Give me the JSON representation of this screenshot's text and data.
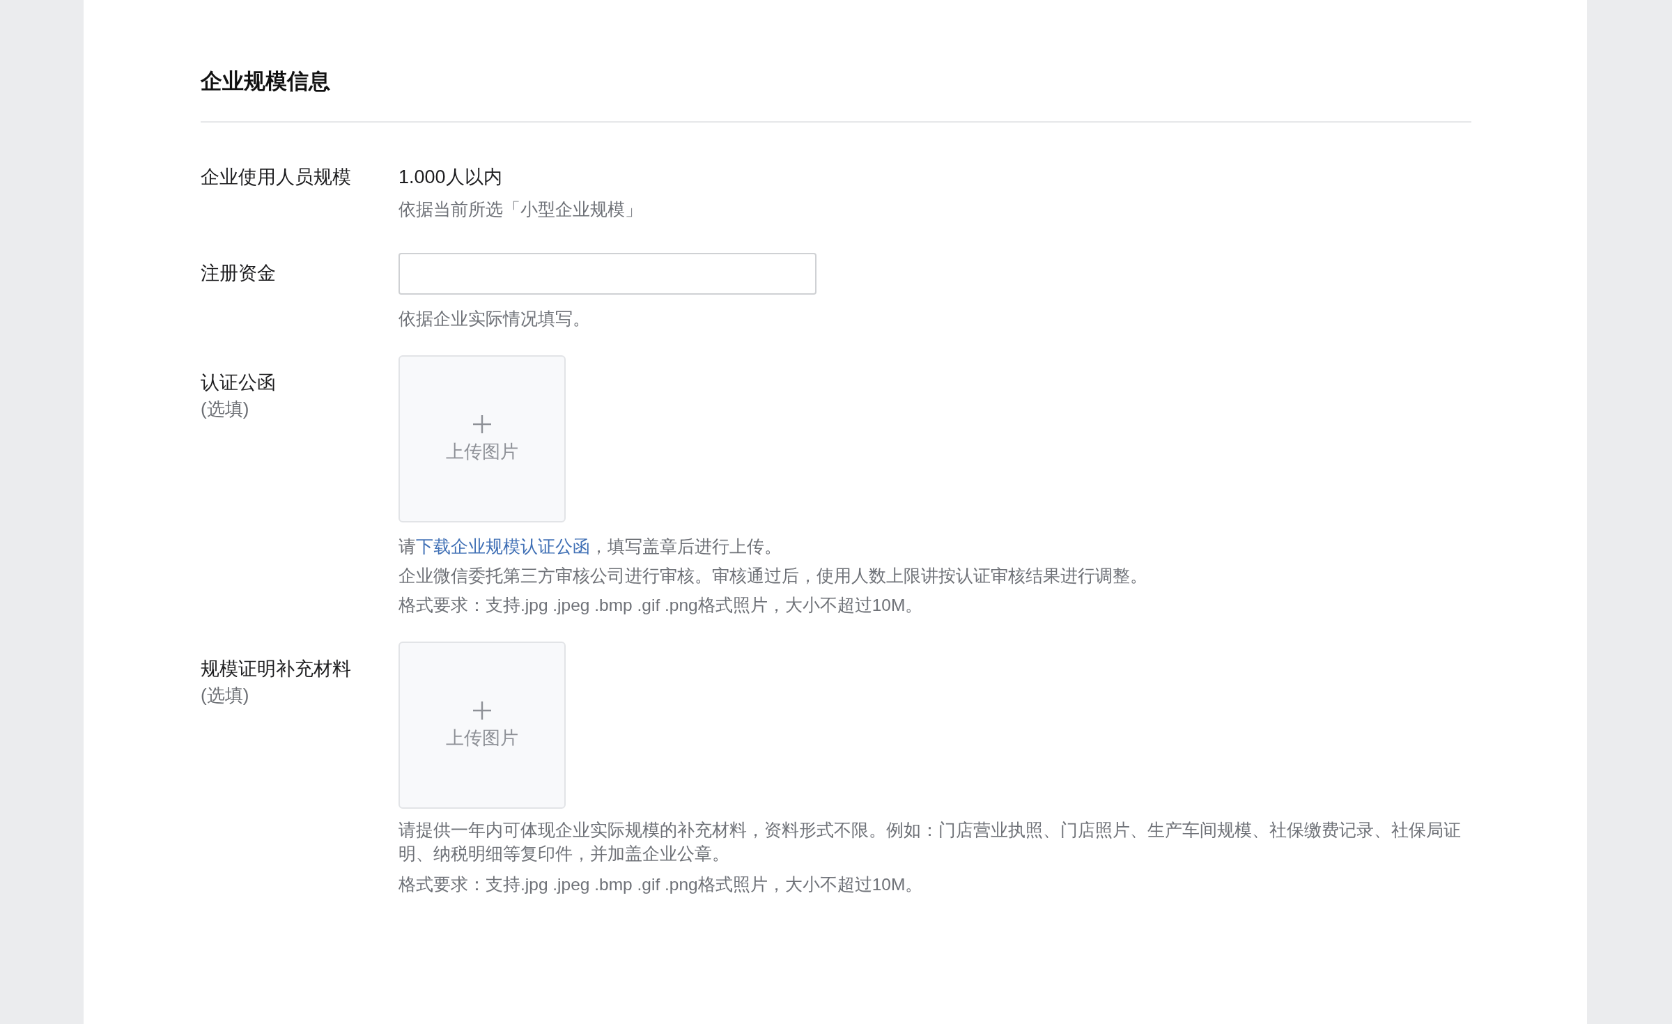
{
  "section": {
    "title": "企业规模信息"
  },
  "rows": [
    {
      "kind": "text",
      "label": "企业使用人员规模",
      "value": "1.000人以内",
      "hints": [
        [
          {
            "kind": "plain",
            "text": "依据当前所选「小型企业规模」"
          }
        ]
      ]
    },
    {
      "kind": "input",
      "label": "注册资金",
      "hints": [
        [
          {
            "kind": "plain",
            "text": "依据企业实际情况填写。"
          }
        ]
      ]
    },
    {
      "kind": "upload",
      "label": "认证公函",
      "optional": "(选填)",
      "upload_label": "上传图片",
      "hints": [
        [
          {
            "kind": "plain",
            "text": "请"
          },
          {
            "kind": "link",
            "text": "下载企业规模认证公函"
          },
          {
            "kind": "plain",
            "text": "，填写盖章后进行上传。"
          }
        ],
        [
          {
            "kind": "plain",
            "text": "企业微信委托第三方审核公司进行审核。审核通过后，使用人数上限讲按认证审核结果进行调整。"
          }
        ],
        [
          {
            "kind": "plain",
            "text": "格式要求：支持.jpg .jpeg .bmp .gif .png格式照片，大小不超过10M。"
          }
        ]
      ]
    },
    {
      "kind": "upload",
      "label": "规模证明补充材料",
      "optional": "(选填)",
      "upload_label": "上传图片",
      "hints": [
        [
          {
            "kind": "plain",
            "text": "请提供一年内可体现企业实际规模的补充材料，资料形式不限。例如：门店营业执照、门店照片、生产车间规模、社保缴费记录、社保局证明、纳税明细等复印件，并加盖企业公章。"
          }
        ],
        [
          {
            "kind": "plain",
            "text": "格式要求：支持.jpg .jpeg .bmp .gif .png格式照片，大小不超过10M。"
          }
        ]
      ]
    }
  ]
}
